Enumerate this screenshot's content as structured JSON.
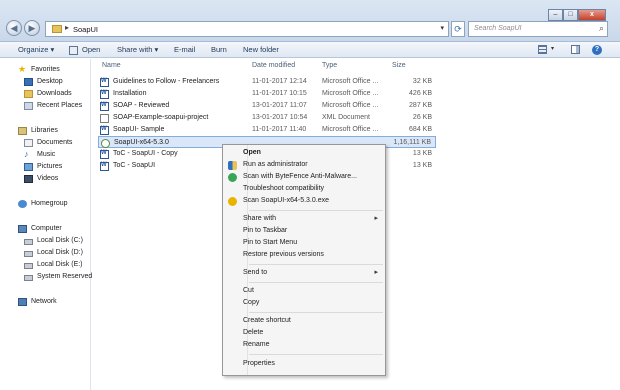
{
  "window": {
    "address_path": "SoapUI",
    "search_placeholder": "Search SoapUI",
    "refresh_glyph": "⟳",
    "min_glyph": "–",
    "max_glyph": "□",
    "close_glyph": "x"
  },
  "toolbar": {
    "organize": "Organize ▾",
    "open": "Open",
    "share_with": "Share with ▾",
    "email": "E-mail",
    "burn": "Burn",
    "new_folder": "New folder",
    "help_glyph": "?"
  },
  "navigation": {
    "favorites": "Favorites",
    "desktop": "Desktop",
    "downloads": "Downloads",
    "recent_places": "Recent Places",
    "libraries": "Libraries",
    "documents": "Documents",
    "music": "Music",
    "pictures": "Pictures",
    "videos": "Videos",
    "homegroup": "Homegroup",
    "computer": "Computer",
    "local_c": "Local Disk (C:)",
    "local_d": "Local Disk (D:)",
    "local_e": "Local Disk (E:)",
    "system_reserved": "System Reserved",
    "network": "Network"
  },
  "columns": {
    "name": "Name",
    "date_modified": "Date modified",
    "type": "Type",
    "size": "Size"
  },
  "files": [
    {
      "name": "Guidelines to Follow - Freelancers",
      "date": "11-01-2017 12:14",
      "type": "Microsoft Office ...",
      "size": "32 KB",
      "icon": "word-icon"
    },
    {
      "name": "Installation",
      "date": "11-01-2017 10:15",
      "type": "Microsoft Office ...",
      "size": "426 KB",
      "icon": "word-icon"
    },
    {
      "name": "SOAP - Reviewed",
      "date": "13-01-2017 11:07",
      "type": "Microsoft Office ...",
      "size": "287 KB",
      "icon": "word-icon"
    },
    {
      "name": "SOAP-Example-soapui-project",
      "date": "13-01-2017 10:54",
      "type": "XML Document",
      "size": "26 KB",
      "icon": "xml-icon"
    },
    {
      "name": "SoapUI- Sample",
      "date": "11-01-2017 11:40",
      "type": "Microsoft Office ...",
      "size": "684 KB",
      "icon": "word-icon"
    },
    {
      "name": "SoapUI-x64-5.3.0",
      "date": "",
      "type": "",
      "size": "1,16,111 KB",
      "icon": "exe-icon"
    },
    {
      "name": "ToC - SoapUI - Copy",
      "date": "",
      "type": "",
      "size": "13 KB",
      "icon": "word-icon"
    },
    {
      "name": "ToC - SoapUI",
      "date": "",
      "type": "",
      "size": "13 KB",
      "icon": "word-icon"
    }
  ],
  "context_menu": {
    "open": "Open",
    "run_as_admin": "Run as administrator",
    "scan_bytefence": "Scan with ByteFence Anti-Malware...",
    "troubleshoot": "Troubleshoot compatibility",
    "scan_exe": "Scan SoapUI-x64-5.3.0.exe",
    "share_with": "Share with",
    "pin_taskbar": "Pin to Taskbar",
    "pin_start": "Pin to Start Menu",
    "restore_versions": "Restore previous versions",
    "send_to": "Send to",
    "cut": "Cut",
    "copy": "Copy",
    "create_shortcut": "Create shortcut",
    "delete": "Delete",
    "rename": "Rename",
    "properties": "Properties",
    "submenu_arrow": "▸"
  },
  "colors": {
    "selection_bg": "#d9e7f8",
    "selection_border": "#84acdd",
    "menu_bg": "#f5f5f5"
  }
}
